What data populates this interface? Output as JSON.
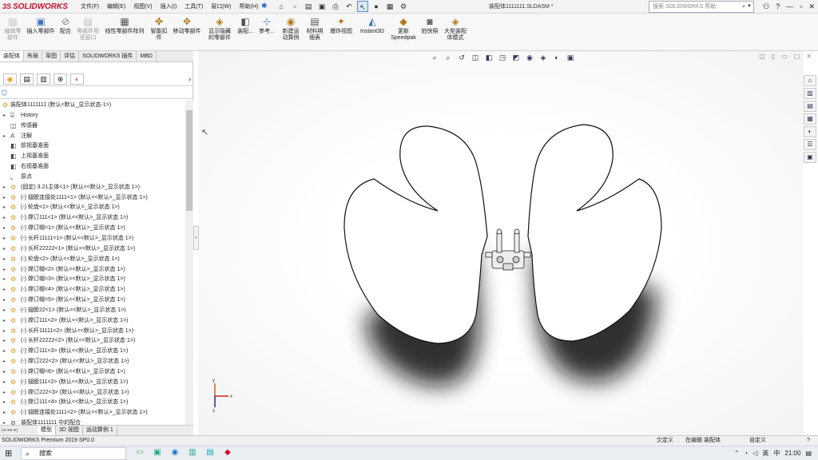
{
  "app": {
    "logo": "SOLIDWORKS",
    "logo_ds": "3S",
    "title": "装配体1111111.SLDASM *",
    "menu": [
      "文件(F)",
      "编辑(E)",
      "视图(V)",
      "插入(I)",
      "工具(T)",
      "窗口(W)",
      "帮助(H)"
    ],
    "search_placeholder": "搜索 SOLIDWORKS 帮助",
    "win_buttons": [
      "—",
      "▫",
      "✕"
    ]
  },
  "ribbon": {
    "buttons": [
      {
        "label": "编辑零\n部件",
        "disabled": true,
        "icon": "edit-component-icon"
      },
      {
        "label": "插入零部件",
        "disabled": false,
        "icon": "insert-component-icon"
      },
      {
        "label": "配合",
        "disabled": false,
        "icon": "mate-icon"
      },
      {
        "label": "零部件预\n览窗口",
        "disabled": true,
        "icon": "component-preview-icon"
      },
      {
        "label": "线性零部件阵列",
        "disabled": false,
        "icon": "linear-pattern-icon"
      },
      {
        "label": "智能扣\n件",
        "disabled": false,
        "icon": "smart-fasteners-icon"
      },
      {
        "label": "移动零部件",
        "disabled": false,
        "icon": "move-component-icon"
      },
      {
        "label": "显示隐藏\n的零部件",
        "disabled": false,
        "icon": "show-hidden-icon"
      },
      {
        "label": "装配...",
        "disabled": false,
        "icon": "assembly-features-icon"
      },
      {
        "label": "参考...",
        "disabled": false,
        "icon": "reference-geometry-icon"
      },
      {
        "label": "新建运\n动算例",
        "disabled": false,
        "icon": "new-motion-study-icon"
      },
      {
        "label": "材料明\n细表",
        "disabled": false,
        "icon": "bill-of-materials-icon"
      },
      {
        "label": "爆炸视图",
        "disabled": false,
        "icon": "exploded-view-icon"
      },
      {
        "label": "Instant3D",
        "disabled": false,
        "icon": "instant3d-icon"
      },
      {
        "label": "更新\nSpeedpak",
        "disabled": false,
        "icon": "speedpak-icon"
      },
      {
        "label": "拍快照",
        "disabled": false,
        "icon": "snapshot-icon"
      },
      {
        "label": "大型装配\n体模式",
        "disabled": false,
        "icon": "large-assembly-icon"
      }
    ]
  },
  "command_tabs": [
    "装配体",
    "布局",
    "草图",
    "评估",
    "SOLIDWORKS 插件",
    "MBD"
  ],
  "bottom_tabs": [
    "模型",
    "3D 视图",
    "运动算例 1"
  ],
  "tree": {
    "root": "装配体1111111 (默认<默认_显示状态-1>)",
    "items": [
      {
        "label": "History",
        "icon": "history-icon",
        "expand": true
      },
      {
        "label": "传感器",
        "icon": "sensor-icon",
        "expand": false
      },
      {
        "label": "注解",
        "icon": "annotation-icon",
        "expand": true
      },
      {
        "label": "前视基准面",
        "icon": "plane-icon",
        "expand": false
      },
      {
        "label": "上视基准面",
        "icon": "plane-icon",
        "expand": false
      },
      {
        "label": "右视基准面",
        "icon": "plane-icon",
        "expand": false
      },
      {
        "label": "原点",
        "icon": "origin-icon",
        "expand": false
      },
      {
        "label": "(固定) 3.21主体<1> (默认<<默认>_显示状态 1>)",
        "icon": "part-icon",
        "expand": true
      },
      {
        "label": "(-) 翅膀连接处1111<1> (默认<<默认>_显示状态 1>)",
        "icon": "part-icon",
        "expand": true
      },
      {
        "label": "(-) 轮盘<1> (默认<<默认>_显示状态 1>)",
        "icon": "part-icon",
        "expand": true
      },
      {
        "label": "(-) 嫦订111<1> (默认<<默认>_显示状态 1>)",
        "icon": "part-icon",
        "expand": true
      },
      {
        "label": "(-) 嫦订帽<1> (默认<<默认>_显示状态 1>)",
        "icon": "part-icon",
        "expand": true
      },
      {
        "label": "(-) 长杆11111<1> (默认<<默认>_显示状态 1>)",
        "icon": "part-icon",
        "expand": true
      },
      {
        "label": "(-) 长杆22222<1> (默认<<默认>_显示状态 1>)",
        "icon": "part-icon",
        "expand": true
      },
      {
        "label": "(-) 轮盘<2> (默认<<默认>_显示状态 1>)",
        "icon": "part-icon",
        "expand": true
      },
      {
        "label": "(-) 嫦订帽<2> (默认<<默认>_显示状态 1>)",
        "icon": "part-icon",
        "expand": true
      },
      {
        "label": "(-) 嫦订帽<3> (默认<<默认>_显示状态 1>)",
        "icon": "part-icon",
        "expand": true
      },
      {
        "label": "(-) 嫦订帽<4> (默认<<默认>_显示状态 1>)",
        "icon": "part-icon",
        "expand": true
      },
      {
        "label": "(-) 嫦订帽<5> (默认<<默认>_显示状态 1>)",
        "icon": "part-icon",
        "expand": true
      },
      {
        "label": "(-) 翅膀22<1> (默认<<默认>_显示状态 1>)",
        "icon": "part-icon",
        "expand": true
      },
      {
        "label": "(-) 嫦订111<2> (默认<<默认>_显示状态 1>)",
        "icon": "part-icon",
        "expand": true
      },
      {
        "label": "(-) 长杆11111<2> (默认<<默认>_显示状态 1>)",
        "icon": "part-icon",
        "expand": true
      },
      {
        "label": "(-) 长杆22222<2> (默认<<默认>_显示状态 1>)",
        "icon": "part-icon",
        "expand": true
      },
      {
        "label": "(-) 嫦订111<3> (默认<<默认>_显示状态 1>)",
        "icon": "part-icon",
        "expand": true
      },
      {
        "label": "(-) 嫦订222<2> (默认<<默认>_显示状态 1>)",
        "icon": "part-icon",
        "expand": true
      },
      {
        "label": "(-) 嫦订帽<6> (默认<<默认>_显示状态 1>)",
        "icon": "part-icon",
        "expand": true
      },
      {
        "label": "(-) 翅膀111<2> (默认<<默认>_显示状态 1>)",
        "icon": "part-icon",
        "expand": true
      },
      {
        "label": "(-) 嫦订222<3> (默认<<默认>_显示状态 1>)",
        "icon": "part-icon",
        "expand": true
      },
      {
        "label": "(-) 嫦订111<4> (默认<<默认>_显示状态 1>)",
        "icon": "part-icon",
        "expand": true
      },
      {
        "label": "(-) 翅膀连接处1111<2> (默认<<默认>_显示状态 1>)",
        "icon": "part-icon",
        "expand": true
      },
      {
        "label": "装配体1111111 中的配合",
        "icon": "mates-icon",
        "expand": true
      }
    ]
  },
  "status": {
    "version": "SOLIDWORKS Premium 2019 SP0.0",
    "s1": "欠定义",
    "s2": "在编辑 装配体",
    "s3": "自定义",
    "s4": "?"
  },
  "taskbar": {
    "search": "搜索",
    "ime": "中",
    "time": "21:00",
    "lang": "英"
  },
  "triad": {
    "x": "x",
    "y": "y",
    "z": "z"
  },
  "colors": {
    "accent": "#1e66c8",
    "brand": "#c8102e",
    "part": "#d89a18"
  }
}
